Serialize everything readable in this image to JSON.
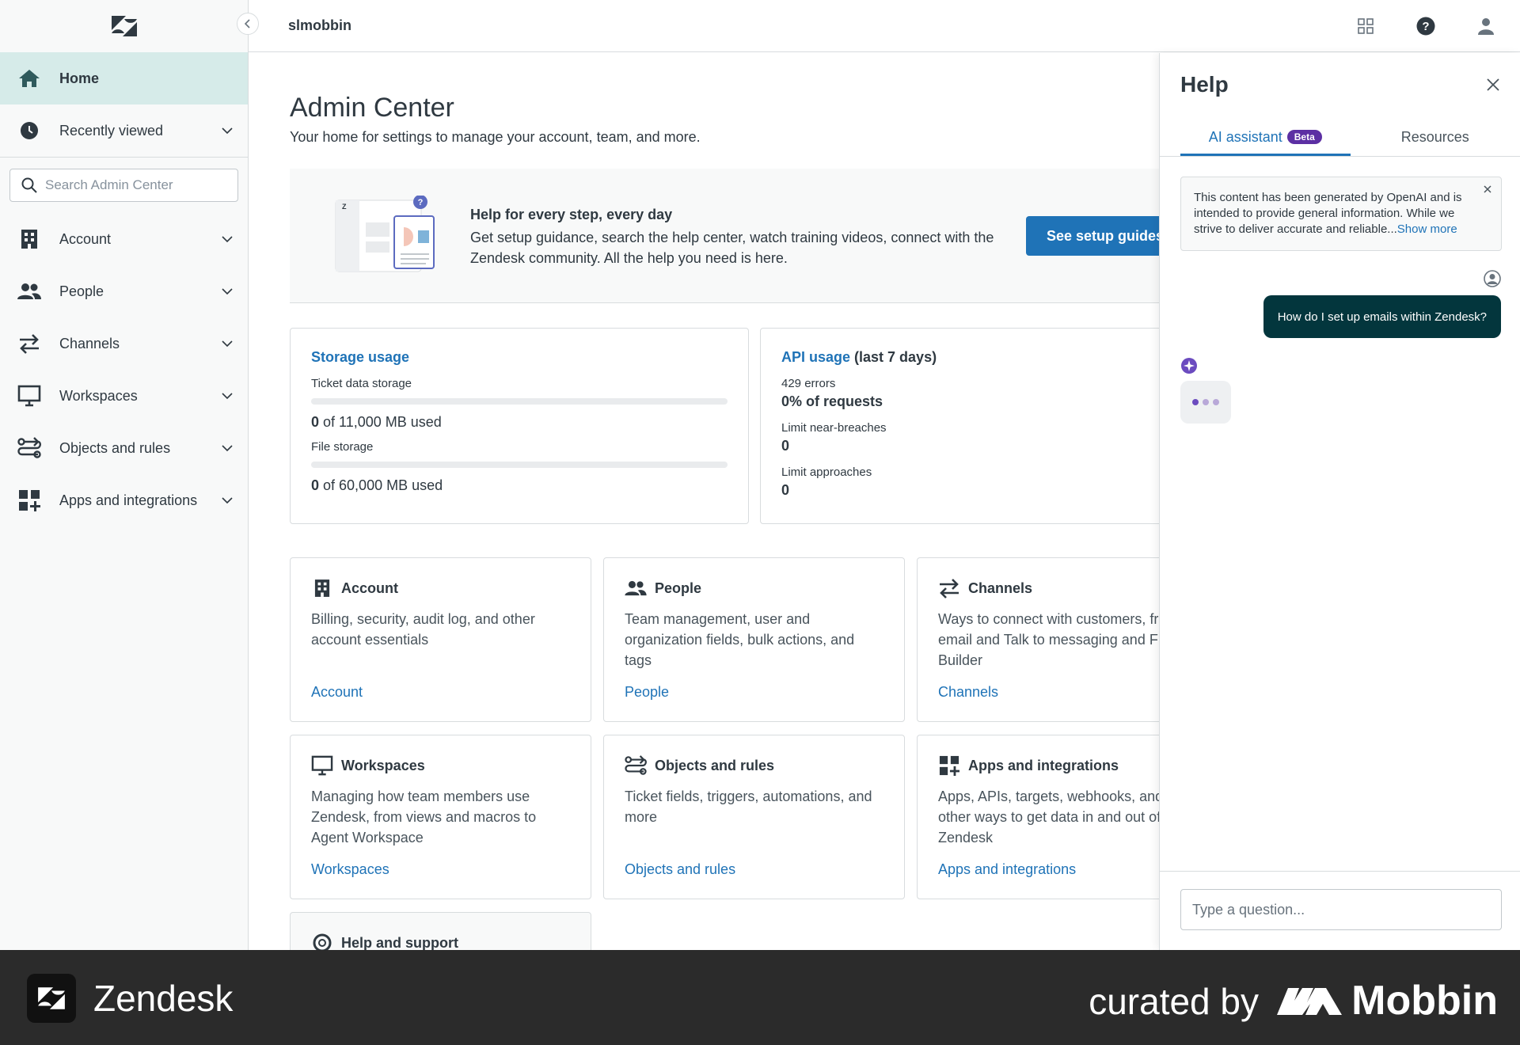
{
  "app": {
    "account_name": "slmobbin"
  },
  "sidebar": {
    "items": [
      {
        "label": "Home",
        "icon": "home-icon",
        "active": true
      },
      {
        "label": "Recently viewed",
        "icon": "clock-icon"
      }
    ],
    "search_placeholder": "Search Admin Center",
    "sections": [
      {
        "label": "Account",
        "icon": "building-icon"
      },
      {
        "label": "People",
        "icon": "people-icon"
      },
      {
        "label": "Channels",
        "icon": "arrows-icon"
      },
      {
        "label": "Workspaces",
        "icon": "monitor-icon"
      },
      {
        "label": "Objects and rules",
        "icon": "flow-icon"
      },
      {
        "label": "Apps and integrations",
        "icon": "apps-icon"
      }
    ]
  },
  "main": {
    "title": "Admin Center",
    "subtitle": "Your home for settings to manage your account, team, and more.",
    "banner": {
      "title": "Help for every step, every day",
      "text": "Get setup guidance, search the help center, watch training videos, connect with the Zendesk community. All the help you need is here.",
      "button": "See setup guides"
    },
    "storage": {
      "title": "Storage usage",
      "ticket_label": "Ticket data storage",
      "ticket_used": "0",
      "ticket_rest": " of 11,000 MB used",
      "ticket_fraction": 0,
      "file_label": "File storage",
      "file_used": "0",
      "file_rest": " of 60,000 MB used",
      "file_fraction": 0
    },
    "api": {
      "title": "API usage",
      "title_suffix": " (last 7 days)",
      "errors_label": "429 errors",
      "errors_value": "0% of requests",
      "breaches_label": "Limit near-breaches",
      "breaches_value": "0",
      "approaches_label": "Limit approaches",
      "approaches_value": "0"
    },
    "tiles": [
      {
        "title": "Account",
        "desc": "Billing, security, audit log, and other account essentials",
        "link": "Account"
      },
      {
        "title": "People",
        "desc": "Team management, user and organization fields, bulk actions, and tags",
        "link": "People"
      },
      {
        "title": "Channels",
        "desc": "Ways to connect with customers, from email and Talk to messaging and Flow Builder",
        "link": "Channels"
      },
      {
        "title": "Workspaces",
        "desc": "Managing how team members use Zendesk, from views and macros to Agent Workspace",
        "link": "Workspaces"
      },
      {
        "title": "Objects and rules",
        "desc": "Ticket fields, triggers, automations, and more",
        "link": "Objects and rules"
      },
      {
        "title": "Apps and integrations",
        "desc": "Apps, APIs, targets, webhooks, and other ways to get data in and out of Zendesk",
        "link": "Apps and integrations"
      },
      {
        "title": "Help and support",
        "desc": "",
        "link": ""
      }
    ]
  },
  "help": {
    "title": "Help",
    "tab_ai": "AI assistant",
    "tab_ai_badge": "Beta",
    "tab_resources": "Resources",
    "disclaimer": "This content has been generated by OpenAI and is intended to provide general information. While we strive to deliver accurate and reliable...",
    "show_more": "Show more",
    "user_message": "How do I set up emails within Zendesk?",
    "input_placeholder": "Type a question..."
  },
  "brandbar": {
    "app_name": "Zendesk",
    "curated_by": "curated by",
    "curator": "Mobbin"
  },
  "colors": {
    "accent": "#1f73b7",
    "active_nav": "#d6ebe9",
    "user_bubble": "#03363d",
    "beta_badge": "#5c2fa3",
    "brandbar_bg": "#2b2b2b"
  }
}
